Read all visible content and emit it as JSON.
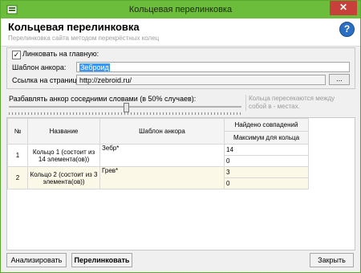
{
  "window": {
    "title": "Кольцевая перелинковка",
    "close_label": "✕"
  },
  "header": {
    "title": "Кольцевая перелинковка",
    "subtitle": "Перелинковка сайта методом перекрёстных колец",
    "help_label": "?"
  },
  "settings": {
    "link_home_checked": true,
    "link_home_label": "Линковать на главную:",
    "anchor_label": "Шаблон анкора:",
    "anchor_value": "Зеброид",
    "url_label": "Ссылка на страницу:",
    "url_value": "http://zebroid.ru/",
    "browse_label": "..."
  },
  "slider": {
    "label": "Разбавлять анкор соседними словами (в 50% случаев):",
    "value_percent": 50
  },
  "hint": "Кольца пересекаются между собой в - местах.",
  "table": {
    "headers": {
      "num": "№",
      "name": "Название",
      "template": "Шаблон анкора",
      "found": "Найдено совпадений",
      "max": "Максимум для кольца"
    },
    "rows": [
      {
        "num": "1",
        "name": "Кольцо 1 (состоит из 14 элемента(ов))",
        "template": "Зебр*",
        "found": "14",
        "max": "0"
      },
      {
        "num": "2",
        "name": "Кольцо 2 (состоит из 3 элемента(ов))",
        "template": "Грев*",
        "found": "3",
        "max": "0"
      }
    ]
  },
  "buttons": {
    "analyze": "Анализировать",
    "link": "Перелинковать",
    "close": "Закрыть"
  },
  "colors": {
    "titlebar": "#6dbd3c",
    "close": "#c7413a",
    "selection": "#3399ff"
  }
}
